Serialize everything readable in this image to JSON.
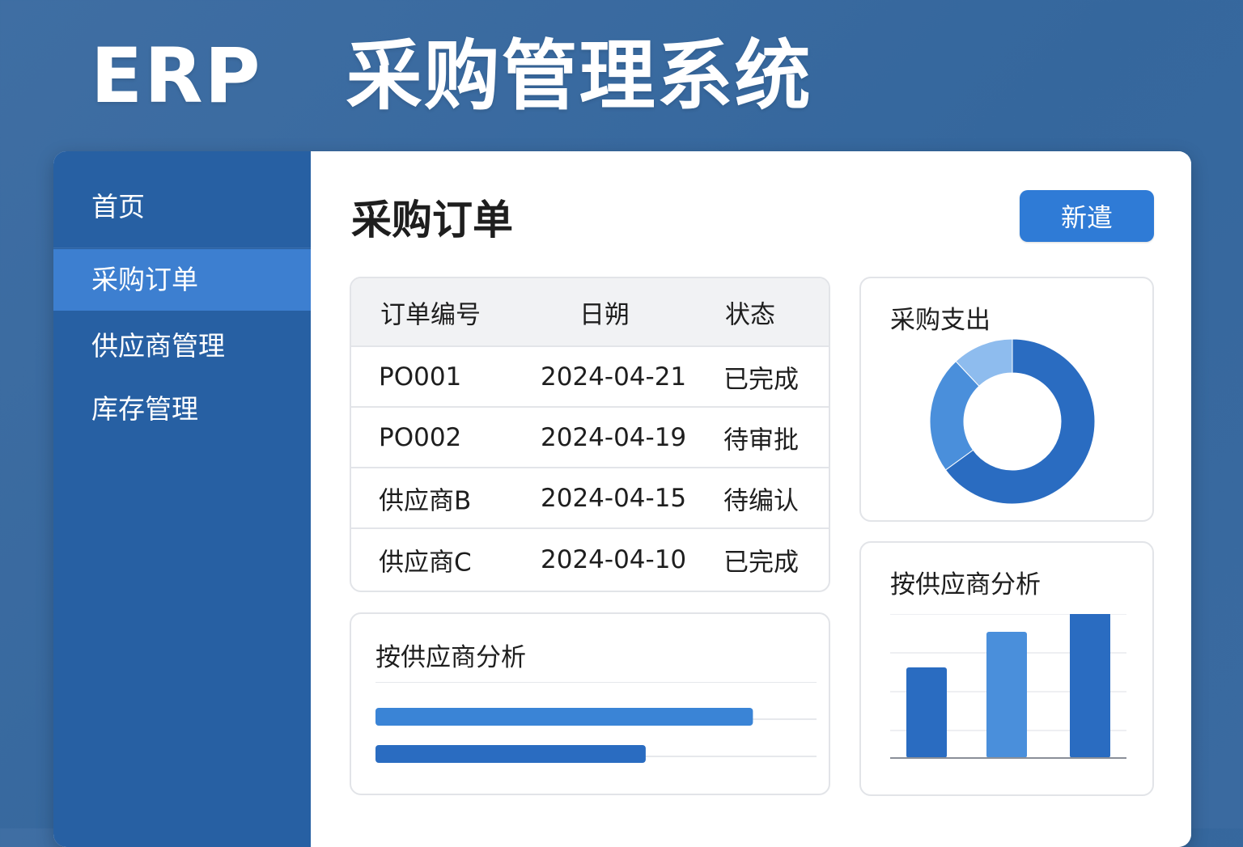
{
  "app": {
    "title": "ERP   采购管理系统"
  },
  "sidebar": {
    "items": [
      {
        "label": "首页",
        "active": false
      },
      {
        "label": "采购订单",
        "active": true
      },
      {
        "label": "供应商管理",
        "active": false
      },
      {
        "label": "库存管理",
        "active": false
      }
    ]
  },
  "main": {
    "title": "采购订单",
    "new_button_label": "新遣"
  },
  "orders_table": {
    "columns": [
      "订单编号",
      "日朔",
      "状态"
    ],
    "rows": [
      [
        "PO001",
        "2024-04-21",
        "已完成"
      ],
      [
        "PO002",
        "2024-04-19",
        "待审批"
      ],
      [
        "供应商B",
        "2024-04-15",
        "待编认"
      ],
      [
        "供应商C",
        "2024-04-10",
        "已完成"
      ]
    ]
  },
  "spend_card": {
    "title": "采购支出"
  },
  "hbar_card": {
    "title": "按供应商分析"
  },
  "vbar_card": {
    "title": "按供应商分析"
  },
  "colors": {
    "background": "#3a6aa0",
    "sidebar": "#2760a3",
    "sidebar_active": "#3d7fd0",
    "accent": "#2f7bd6",
    "bar_dark": "#2a6cc1",
    "bar_mid": "#4a8fdb",
    "bar_light": "#8ebcee"
  },
  "chart_data": [
    {
      "type": "pie",
      "title": "采购支出",
      "donut": true,
      "values": [
        65,
        23,
        12
      ],
      "colors": [
        "#2a6cc1",
        "#4a8fdb",
        "#8ebcee"
      ]
    },
    {
      "type": "bar",
      "orientation": "horizontal",
      "title": "按供应商分析",
      "values": [
        88,
        63
      ],
      "xlim": [
        0,
        100
      ],
      "grid": true,
      "colors": [
        "#3a84d6",
        "#2a6cc1"
      ]
    },
    {
      "type": "bar",
      "orientation": "vertical",
      "title": "按供应商分析",
      "values": [
        56,
        78,
        90
      ],
      "ylim": [
        0,
        100
      ],
      "grid": true,
      "colors": [
        "#2a6cc1",
        "#4a8fdb",
        "#2a6cc1"
      ]
    }
  ]
}
